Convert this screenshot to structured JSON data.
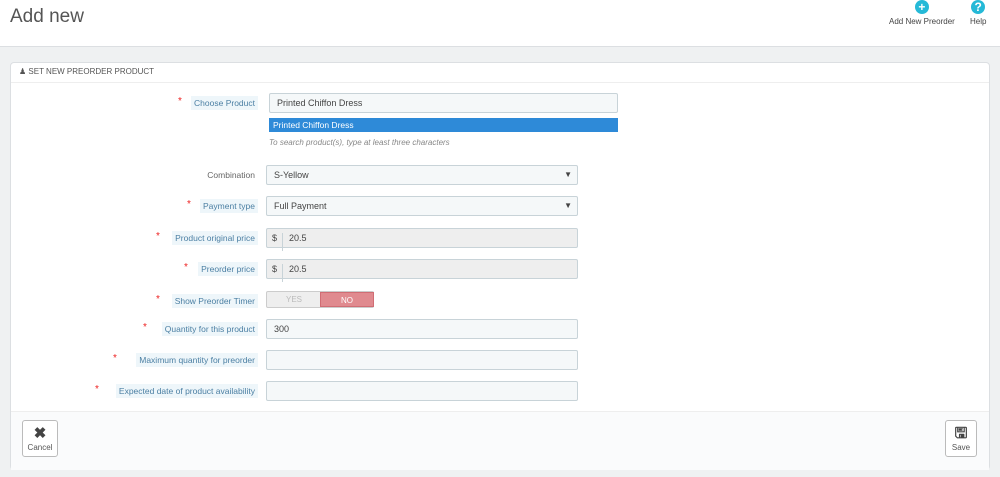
{
  "header": {
    "title": "Add new",
    "add_new": "Add New Preorder",
    "help": "Help"
  },
  "panel": {
    "title": "SET NEW PREORDER PRODUCT",
    "choose_product": {
      "label": "Choose Product",
      "value": "Printed Chiffon Dress",
      "suggestion": "Printed Chiffon Dress",
      "hint": "To search product(s), type at least three characters"
    },
    "combination": {
      "label": "Combination",
      "value": "S-Yellow"
    },
    "payment_type": {
      "label": "Payment type",
      "value": "Full Payment"
    },
    "original_price": {
      "label": "Product original price",
      "currency": "$",
      "value": "20.5"
    },
    "preorder_price": {
      "label": "Preorder price",
      "currency": "$",
      "value": "20.5"
    },
    "timer": {
      "label": "Show Preorder Timer",
      "yes": "YES",
      "no": "NO",
      "selected": "NO"
    },
    "quantity": {
      "label": "Quantity for this product",
      "value": "300"
    },
    "max_quantity": {
      "label": "Maximum quantity for preorder",
      "value": ""
    },
    "expected_date": {
      "label": "Expected date of product availability",
      "value": ""
    },
    "cancel": "Cancel",
    "save": "Save"
  }
}
